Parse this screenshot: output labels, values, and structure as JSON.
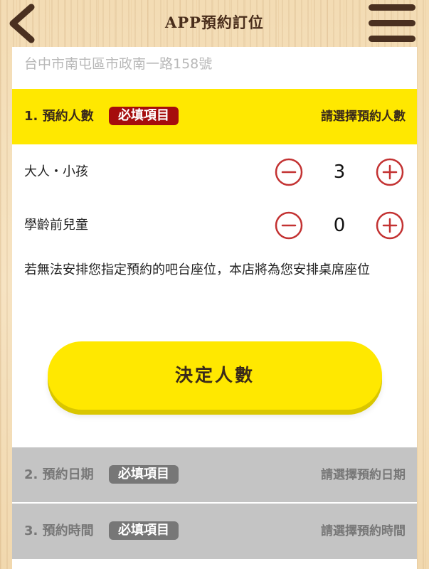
{
  "header": {
    "title": "APP預約訂位",
    "back_icon": "chevron-left-icon",
    "menu_icon": "hamburger-menu-icon"
  },
  "address": "台中市南屯區市政南一路158號",
  "sections": [
    {
      "title": "1. 預約人數",
      "required": "必填項目",
      "hint": "請選擇預約人數"
    },
    {
      "title": "2. 預約日期",
      "required": "必填項目",
      "hint": "請選擇預約日期"
    },
    {
      "title": "3. 預約時間",
      "required": "必填項目",
      "hint": "請選擇預約時間"
    }
  ],
  "party": {
    "adults_label": "大人・小孩",
    "adults_value": "3",
    "preschool_label": "學齡前兒童",
    "preschool_value": "0"
  },
  "notice": "若無法安排您指定預約的吧台座位，本店將為您安排桌席座位",
  "confirm_label": "決定人數",
  "colors": {
    "accent_yellow": "#ffe800",
    "required_red": "#a50d0d",
    "stepper_red": "#c33232",
    "header_brown": "#4a3020",
    "disabled_gray": "#c4c4c4"
  }
}
